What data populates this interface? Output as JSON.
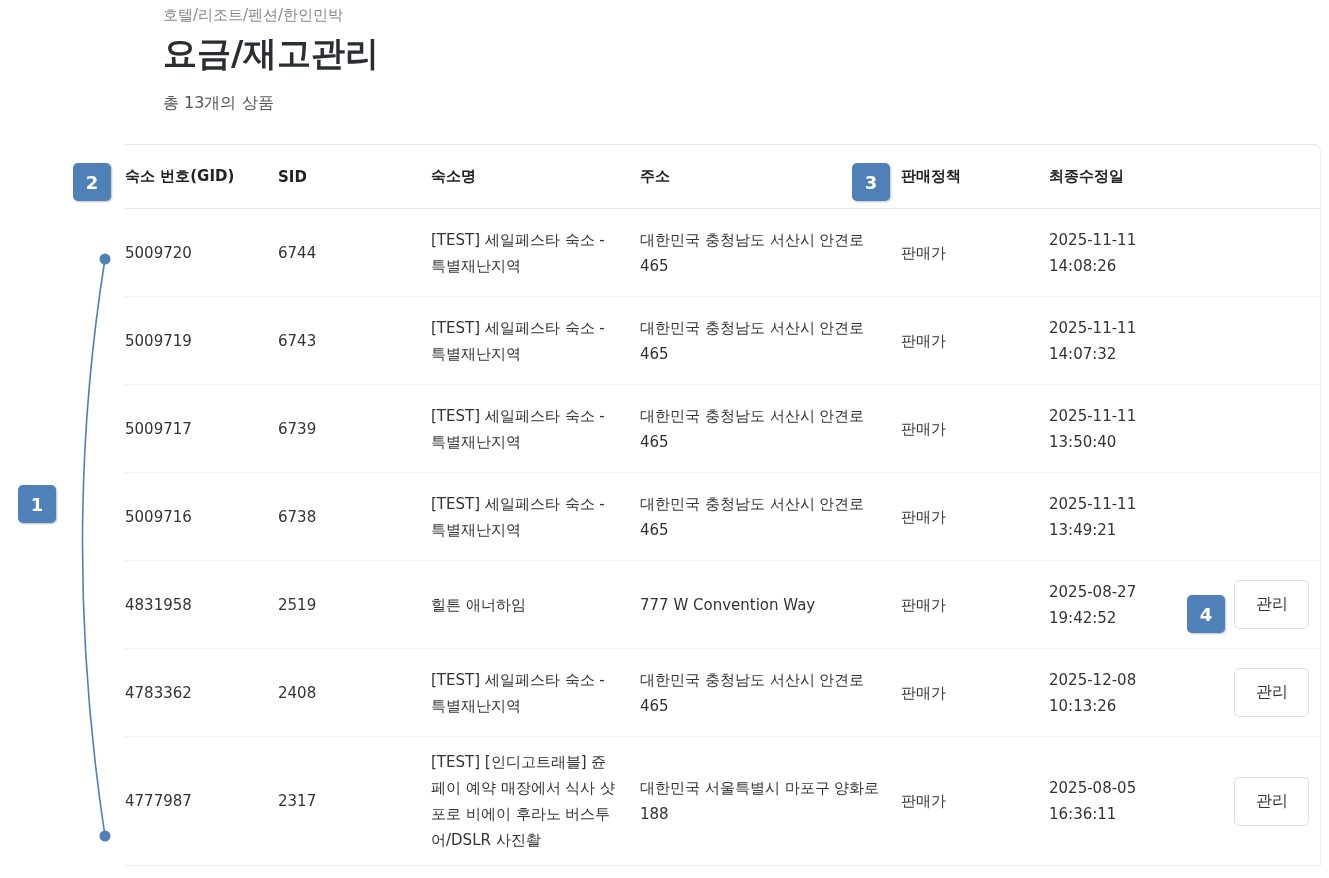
{
  "breadcrumb": "호텔/리조트/펜션/한인민박",
  "title": "요금/재고관리",
  "count": "총 13개의 상품",
  "table": {
    "columns": [
      "숙소 번호(GID)",
      "SID",
      "숙소명",
      "주소",
      "판매정책",
      "최종수정일"
    ],
    "rows": [
      {
        "gid": "5009720",
        "sid": "6744",
        "name": "[TEST] 세일페스타 숙소 - 특별재난지역",
        "address": "대한민국 충청남도 서산시 안견로 465",
        "policy": "판매가",
        "date": "2025-11-11",
        "time": "14:08:26"
      },
      {
        "gid": "5009719",
        "sid": "6743",
        "name": "[TEST] 세일페스타 숙소 - 특별재난지역",
        "address": "대한민국 충청남도 서산시 안견로 465",
        "policy": "판매가",
        "date": "2025-11-11",
        "time": "14:07:32"
      },
      {
        "gid": "5009717",
        "sid": "6739",
        "name": "[TEST] 세일페스타 숙소 - 특별재난지역",
        "address": "대한민국 충청남도 서산시 안견로 465",
        "policy": "판매가",
        "date": "2025-11-11",
        "time": "13:50:40"
      },
      {
        "gid": "5009716",
        "sid": "6738",
        "name": "[TEST] 세일페스타 숙소 - 특별재난지역",
        "address": "대한민국 충청남도 서산시 안견로 465",
        "policy": "판매가",
        "date": "2025-11-11",
        "time": "13:49:21"
      },
      {
        "gid": "4831958",
        "sid": "2519",
        "name": "힐튼 애너하임",
        "address": "777 W Convention Way",
        "policy": "판매가",
        "date": "2025-08-27",
        "time": "19:42:52",
        "button": "관리"
      },
      {
        "gid": "4783362",
        "sid": "2408",
        "name": "[TEST] 세일페스타 숙소 - 특별재난지역",
        "address": "대한민국 충청남도 서산시 안견로 465",
        "policy": "판매가",
        "date": "2025-12-08",
        "time": "10:13:26",
        "button": "관리"
      },
      {
        "gid": "4777987",
        "sid": "2317",
        "name": "[TEST] [인디고트래블] 쥰페이 예약 매장에서 식사 샷포로 비에이 후라노 버스투어/DSLR 사진촬",
        "address": "대한민국 서울특별시 마포구 양화로 188",
        "policy": "판매가",
        "date": "2025-08-05",
        "time": "16:36:11",
        "button": "관리"
      }
    ]
  },
  "annotations": [
    {
      "label": "1",
      "kind": "bracket"
    },
    {
      "label": "2",
      "kind": "badge"
    },
    {
      "label": "3",
      "kind": "badge"
    },
    {
      "label": "4",
      "kind": "badge"
    }
  ]
}
